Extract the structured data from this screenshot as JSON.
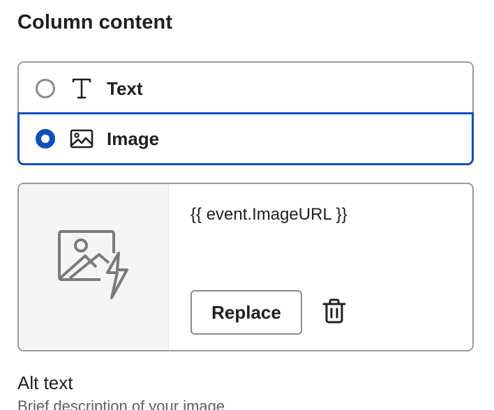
{
  "section": {
    "title": "Column content"
  },
  "content_type": {
    "options": [
      {
        "label": "Text",
        "icon": "text-type-icon",
        "selected": false
      },
      {
        "label": "Image",
        "icon": "image-icon",
        "selected": true
      }
    ]
  },
  "image_block": {
    "thumbnail_icon": "dynamic-image-placeholder-icon",
    "url_value": "{{ event.ImageURL }}",
    "replace_label": "Replace",
    "delete_icon": "trash-icon"
  },
  "alt_text": {
    "label": "Alt text",
    "hint": "Brief description of your image"
  },
  "colors": {
    "accent": "#0b4fc0",
    "border": "#9a9a9a",
    "thumb_bg": "#f4f4f4"
  }
}
